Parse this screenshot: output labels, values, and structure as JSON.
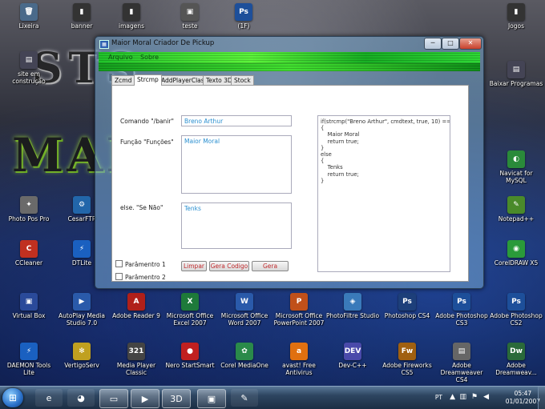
{
  "desktop": {
    "icons": [
      {
        "label": "Lixeira",
        "glyph": "🗑",
        "color": "#4a6a8a",
        "icon": "recycle-bin-icon"
      },
      {
        "label": "banner",
        "glyph": "▮",
        "color": "#333",
        "icon": "file-icon"
      },
      {
        "label": "imagens",
        "glyph": "▮",
        "color": "#333",
        "icon": "file-icon"
      },
      {
        "label": "teste",
        "glyph": "▣",
        "color": "#555",
        "icon": "file-icon"
      },
      {
        "label": "(1F)",
        "glyph": "Ps",
        "color": "#1d4f9a",
        "icon": "photoshop-file-icon"
      },
      {
        "label": "Jogos",
        "glyph": "▮",
        "color": "#333",
        "icon": "folder-icon"
      },
      {
        "label": "site em construção",
        "glyph": "▤",
        "color": "#445",
        "icon": "folder-icon"
      },
      {
        "label": "Baixar Programas",
        "glyph": "▤",
        "color": "#445",
        "icon": "folder-icon"
      },
      {
        "label": "Navicat for MySQL",
        "glyph": "◐",
        "color": "#2a8a3a",
        "icon": "navicat-icon"
      },
      {
        "label": "Photo Pos Pro",
        "glyph": "✦",
        "color": "#6a6a6a",
        "icon": "photo-pos-pro-icon"
      },
      {
        "label": "CesarFTP",
        "glyph": "⚙",
        "color": "#2266aa",
        "icon": "cesarftp-icon"
      },
      {
        "label": "Notepad++",
        "glyph": "✎",
        "color": "#4a8a2a",
        "icon": "notepad-plus-plus-icon"
      },
      {
        "label": "CCleaner",
        "glyph": "C",
        "color": "#c03020",
        "icon": "ccleaner-icon"
      },
      {
        "label": "DTLite",
        "glyph": "⚡",
        "color": "#1a60c0",
        "icon": "dtlite-icon"
      },
      {
        "label": "CorelDRAW X5",
        "glyph": "◉",
        "color": "#2a9a3a",
        "icon": "coreldraw-icon"
      },
      {
        "label": "Virtual Box",
        "glyph": "▣",
        "color": "#2a4a9a",
        "icon": "virtualbox-icon"
      },
      {
        "label": "AutoPlay Media Studio 7.0",
        "glyph": "▶",
        "color": "#2a5aaa",
        "icon": "autoplay-media-studio-icon"
      },
      {
        "label": "Adobe Reader 9",
        "glyph": "A",
        "color": "#b0201a",
        "icon": "adobe-reader-icon"
      },
      {
        "label": "Microsoft Office Excel 2007",
        "glyph": "X",
        "color": "#1e7a3a",
        "icon": "excel-icon"
      },
      {
        "label": "Microsoft Office Word 2007",
        "glyph": "W",
        "color": "#2a5aaa",
        "icon": "word-icon"
      },
      {
        "label": "Microsoft Office PowerPoint 2007",
        "glyph": "P",
        "color": "#c0501a",
        "icon": "powerpoint-icon"
      },
      {
        "label": "PhotoFiltre Studio",
        "glyph": "◈",
        "color": "#3a7aba",
        "icon": "photofiltre-icon"
      },
      {
        "label": "Photoshop CS4",
        "glyph": "Ps",
        "color": "#1d3f7a",
        "icon": "photoshop-icon"
      },
      {
        "label": "Adobe Photoshop CS3",
        "glyph": "Ps",
        "color": "#1d4f9a",
        "icon": "photoshop-icon"
      },
      {
        "label": "Adobe Photoshop CS2",
        "glyph": "Ps",
        "color": "#1d4f9a",
        "icon": "photoshop-icon"
      },
      {
        "label": "DAEMON Tools Lite",
        "glyph": "⚡",
        "color": "#1a60c0",
        "icon": "daemon-tools-icon"
      },
      {
        "label": "VertigoServ",
        "glyph": "✻",
        "color": "#c0a020",
        "icon": "vertigoserv-icon"
      },
      {
        "label": "Media Player Classic",
        "glyph": "321",
        "color": "#444",
        "icon": "media-player-classic-icon"
      },
      {
        "label": "Nero StartSmart",
        "glyph": "●",
        "color": "#c02020",
        "icon": "nero-icon"
      },
      {
        "label": "Corel MediaOne",
        "glyph": "✿",
        "color": "#2a8a4a",
        "icon": "corel-mediaone-icon"
      },
      {
        "label": "avast! Free Antivirus",
        "glyph": "a",
        "color": "#e07010",
        "icon": "avast-icon"
      },
      {
        "label": "Dev-C++",
        "glyph": "DEV",
        "color": "#4a4aaa",
        "icon": "dev-cpp-icon"
      },
      {
        "label": "Adobe Fireworks CS5",
        "glyph": "Fw",
        "color": "#a06010",
        "icon": "fireworks-icon"
      },
      {
        "label": "Adobe Dreamweaver CS4",
        "glyph": "▤",
        "color": "#666",
        "icon": "file-icon"
      },
      {
        "label": "Adobe Dreamweav...",
        "glyph": "Dw",
        "color": "#2a6a3a",
        "icon": "dreamweaver-icon"
      }
    ]
  },
  "window": {
    "title": "Maior Moral Criador De Pickup",
    "minimize": "─",
    "maximize": "□",
    "close": "✕",
    "menu": [
      "Arquivo",
      "Sobre"
    ],
    "tabs": [
      "Zcmd",
      "Strcmp",
      "AddPlayerClass",
      "Texto 3D",
      "Stock"
    ],
    "active_tab": "Strcmp",
    "form": {
      "command_label": "Comando \"/banir\"",
      "command_value": "Breno Arthur",
      "function_label": "Função \"Funções\"",
      "function_value": "Maior Moral",
      "else_label": "else. \"Se Não\"",
      "else_value": "Tenks",
      "param1_label": "Parâmentro 1",
      "param2_label": "Parâmentro 2",
      "btn_clear": "Limpar",
      "btn_generate_code": "Gera Codigo",
      "btn_generate": "Gera",
      "code_output": "if(strcmp(\"Breno Arthur\", cmdtext, true, 10) == 0)\n{\n    Maior Moral\n    return true;\n}\nelse\n{\n    Tenks\n    return true;\n}"
    }
  },
  "taskbar": {
    "language": "PT",
    "time": "05:47",
    "date": "01/01/2007",
    "items": [
      {
        "glyph": "e",
        "icon": "internet-explorer-icon",
        "state": "pinned"
      },
      {
        "glyph": "◕",
        "icon": "firefox-icon",
        "state": "pinned"
      },
      {
        "glyph": "▭",
        "icon": "windows-explorer-icon",
        "state": "running"
      },
      {
        "glyph": "▶",
        "icon": "media-player-icon",
        "state": "running"
      },
      {
        "glyph": "3D",
        "icon": "app-3d-icon",
        "state": "running"
      },
      {
        "glyph": "▣",
        "icon": "creator-app-icon",
        "state": "running"
      },
      {
        "glyph": "✎",
        "icon": "paint-icon",
        "state": "pinned"
      }
    ]
  }
}
